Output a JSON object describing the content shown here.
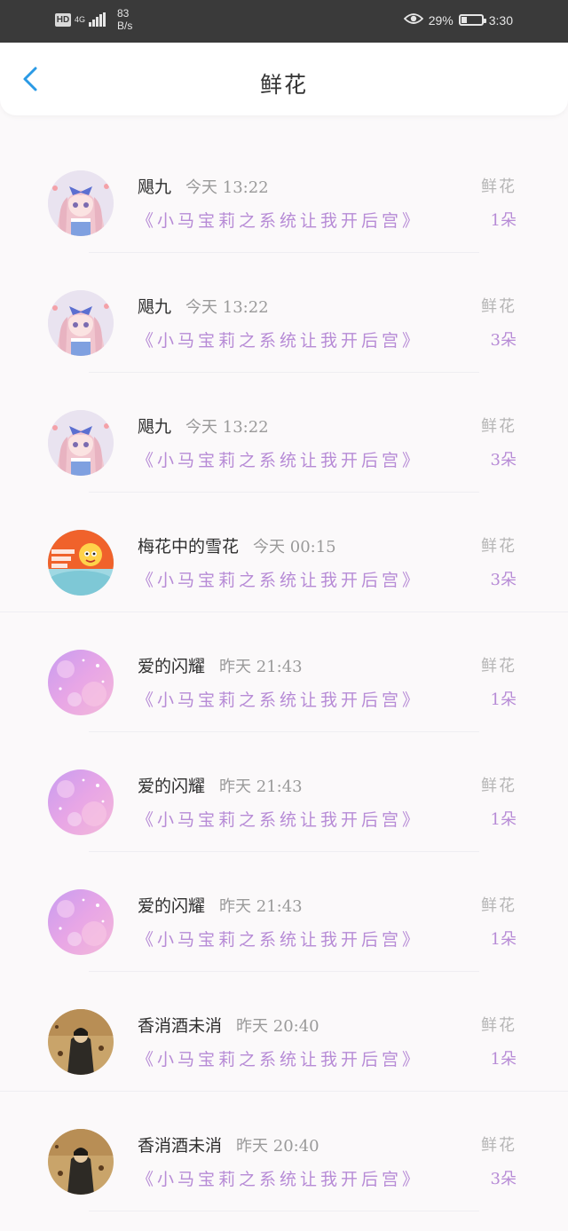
{
  "status_bar": {
    "hd": "HD",
    "network": "4G",
    "speed_value": "83",
    "speed_unit": "B/s",
    "battery": "29%",
    "battery_level": 0.29,
    "time": "3:30"
  },
  "header": {
    "title": "鲜花",
    "back_icon": "chevron-left-icon",
    "accent_color": "#2a9ae5"
  },
  "list": {
    "items": [
      {
        "name": "飓九",
        "time": "今天 13:22",
        "book": "《小马宝莉之系统让我开后宫》",
        "type": "鲜花",
        "count": "1朵",
        "avatar": "anime-girl"
      },
      {
        "name": "飓九",
        "time": "今天 13:22",
        "book": "《小马宝莉之系统让我开后宫》",
        "type": "鲜花",
        "count": "3朵",
        "avatar": "anime-girl"
      },
      {
        "name": "飓九",
        "time": "今天 13:22",
        "book": "《小马宝莉之系统让我开后宫》",
        "type": "鲜花",
        "count": "3朵",
        "avatar": "anime-girl"
      },
      {
        "name": "梅花中的雪花",
        "time": "今天 00:15",
        "book": "《小马宝莉之系统让我开后宫》",
        "type": "鲜花",
        "count": "3朵",
        "avatar": "cartoon-badge"
      },
      {
        "name": "爱的闪耀",
        "time": "昨天 21:43",
        "book": "《小马宝莉之系统让我开后宫》",
        "type": "鲜花",
        "count": "1朵",
        "avatar": "purple-sky"
      },
      {
        "name": "爱的闪耀",
        "time": "昨天 21:43",
        "book": "《小马宝莉之系统让我开后宫》",
        "type": "鲜花",
        "count": "1朵",
        "avatar": "purple-sky"
      },
      {
        "name": "爱的闪耀",
        "time": "昨天 21:43",
        "book": "《小马宝莉之系统让我开后宫》",
        "type": "鲜花",
        "count": "1朵",
        "avatar": "purple-sky"
      },
      {
        "name": "香消酒未消",
        "time": "昨天 20:40",
        "book": "《小马宝莉之系统让我开后宫》",
        "type": "鲜花",
        "count": "1朵",
        "avatar": "vintage-photo"
      },
      {
        "name": "香消酒未消",
        "time": "昨天 20:40",
        "book": "《小马宝莉之系统让我开后宫》",
        "type": "鲜花",
        "count": "3朵",
        "avatar": "vintage-photo"
      }
    ]
  }
}
